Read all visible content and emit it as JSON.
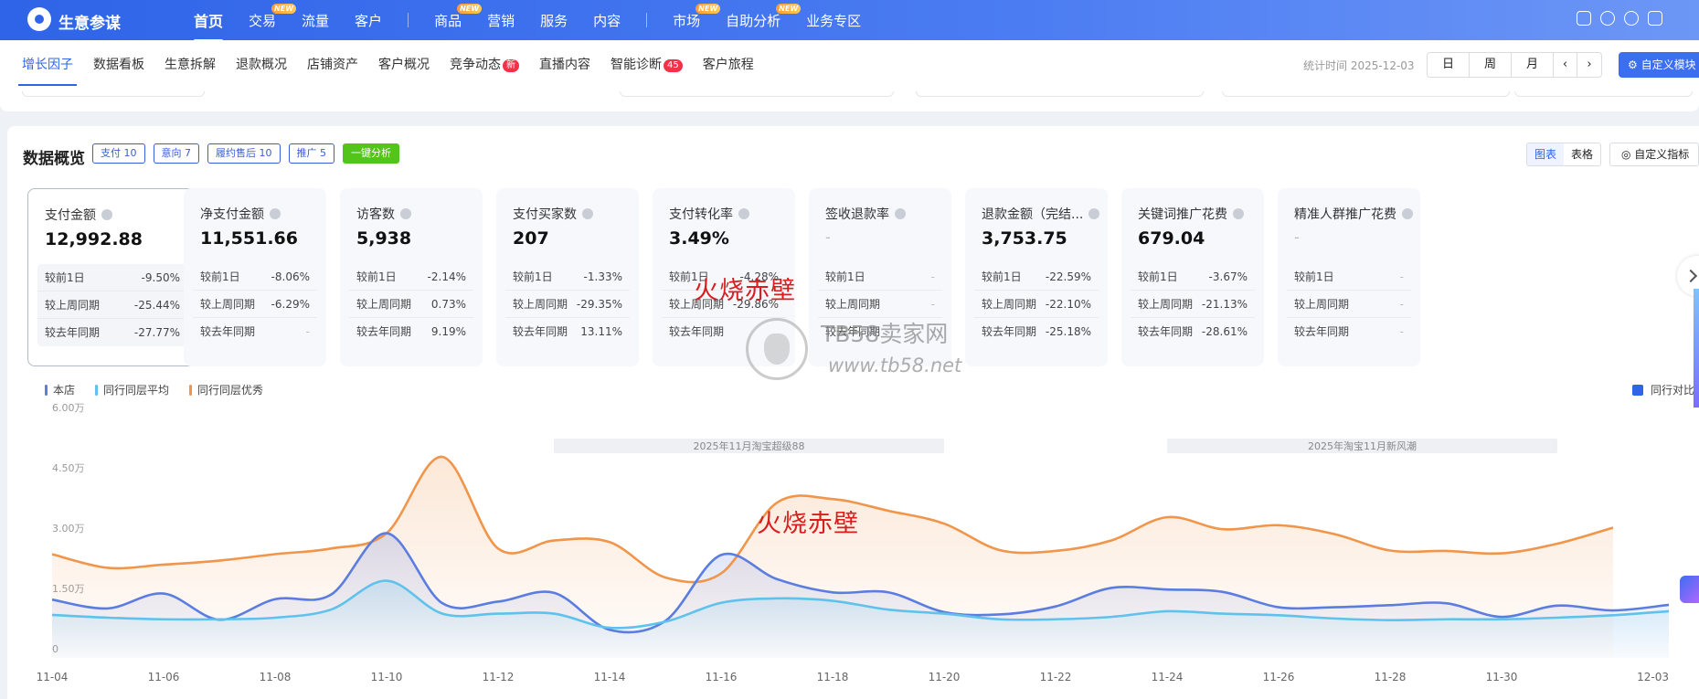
{
  "brand": "生意参谋",
  "top_nav": [
    {
      "label": "首页",
      "active": true
    },
    {
      "label": "交易",
      "new": true
    },
    {
      "label": "流量"
    },
    {
      "label": "客户"
    },
    {
      "label": "商品",
      "new": true
    },
    {
      "label": "营销"
    },
    {
      "label": "服务"
    },
    {
      "label": "内容"
    },
    {
      "label": "市场",
      "new": true
    },
    {
      "label": "自助分析",
      "new": true
    },
    {
      "label": "业务专区"
    }
  ],
  "new_tag": "NEW",
  "sub_nav": [
    {
      "label": "增长因子",
      "active": true
    },
    {
      "label": "数据看板"
    },
    {
      "label": "生意拆解"
    },
    {
      "label": "退款概况"
    },
    {
      "label": "店铺资产"
    },
    {
      "label": "客户概况"
    },
    {
      "label": "竞争动态",
      "badge": "新"
    },
    {
      "label": "直播内容"
    },
    {
      "label": "智能诊断",
      "badge": "45"
    },
    {
      "label": "客户旅程"
    }
  ],
  "stat_time": "统计时间 2025-12-03",
  "period": {
    "day": "日",
    "week": "周",
    "month": "月"
  },
  "custom_module": "自定义模块",
  "overview": {
    "title": "数据概览",
    "chips": [
      "支付 10",
      "意向 7",
      "履约售后 10",
      "推广 5"
    ],
    "one_click": "一键分析",
    "view_chart": "图表",
    "view_table": "表格",
    "custom_metric": "自定义指标"
  },
  "metrics": [
    {
      "name": "支付金额",
      "value": "12,992.88",
      "selected": true,
      "rows": [
        [
          "较前1日",
          "-9.50%"
        ],
        [
          "较上周同期",
          "-25.44%"
        ],
        [
          "较去年同期",
          "-27.77%"
        ]
      ]
    },
    {
      "name": "净支付金额",
      "value": "11,551.66",
      "rows": [
        [
          "较前1日",
          "-8.06%"
        ],
        [
          "较上周同期",
          "-6.29%"
        ],
        [
          "较去年同期",
          "-"
        ]
      ]
    },
    {
      "name": "访客数",
      "value": "5,938",
      "rows": [
        [
          "较前1日",
          "-2.14%"
        ],
        [
          "较上周同期",
          "0.73%"
        ],
        [
          "较去年同期",
          "9.19%"
        ]
      ]
    },
    {
      "name": "支付买家数",
      "value": "207",
      "rows": [
        [
          "较前1日",
          "-1.33%"
        ],
        [
          "较上周同期",
          "-29.35%"
        ],
        [
          "较去年同期",
          "13.11%"
        ]
      ]
    },
    {
      "name": "支付转化率",
      "value": "3.49%",
      "rows": [
        [
          "较前1日",
          "-4.28%"
        ],
        [
          "较上周同期",
          "-29.86%"
        ],
        [
          "较去年同期",
          ""
        ]
      ]
    },
    {
      "name": "签收退款率",
      "value": "-",
      "rows": [
        [
          "较前1日",
          "-"
        ],
        [
          "较上周同期",
          "-"
        ],
        [
          "较去年同期",
          "-"
        ]
      ]
    },
    {
      "name": "退款金额（完结...",
      "value": "3,753.75",
      "rows": [
        [
          "较前1日",
          "-22.59%"
        ],
        [
          "较上周同期",
          "-22.10%"
        ],
        [
          "较去年同期",
          "-25.18%"
        ]
      ]
    },
    {
      "name": "关键词推广花费",
      "value": "679.04",
      "rows": [
        [
          "较前1日",
          "-3.67%"
        ],
        [
          "较上周同期",
          "-21.13%"
        ],
        [
          "较去年同期",
          "-28.61%"
        ]
      ]
    },
    {
      "name": "精准人群推广花费",
      "value": "-",
      "rows": [
        [
          "较前1日",
          "-"
        ],
        [
          "较上周同期",
          "-"
        ],
        [
          "较去年同期",
          "-"
        ]
      ]
    }
  ],
  "compare_label": "同行对比",
  "watermarks": {
    "red": "火烧赤壁",
    "site": "TB58卖家网",
    "url": "www.tb58.net"
  },
  "chart_data": {
    "type": "area",
    "x": [
      "11-04",
      "11-05",
      "11-06",
      "11-07",
      "11-08",
      "11-09",
      "11-10",
      "11-11",
      "11-12",
      "11-13",
      "11-14",
      "11-15",
      "11-16",
      "11-17",
      "11-18",
      "11-19",
      "11-20",
      "11-21",
      "11-22",
      "11-23",
      "11-24",
      "11-25",
      "11-26",
      "11-27",
      "11-28",
      "11-29",
      "11-30",
      "12-01",
      "12-02",
      "12-03"
    ],
    "x_ticks": [
      "11-04",
      "11-06",
      "11-08",
      "11-10",
      "11-12",
      "11-14",
      "11-16",
      "11-18",
      "11-20",
      "11-22",
      "11-24",
      "11-26",
      "11-28",
      "11-30",
      "12-03"
    ],
    "y_ticks": [
      "0",
      "1.50万",
      "3.00万",
      "4.50万",
      "6.00万"
    ],
    "ylim": [
      0,
      60000
    ],
    "series": [
      {
        "name": "本店",
        "color": "#5b7de0",
        "values": [
          14500,
          12300,
          16000,
          9500,
          14600,
          15700,
          31000,
          13600,
          14000,
          16200,
          7000,
          9200,
          25600,
          19600,
          16300,
          16300,
          11400,
          10800,
          12800,
          17400,
          17000,
          16400,
          12600,
          12600,
          13100,
          13600,
          10200,
          13000,
          11800,
          13200
        ]
      },
      {
        "name": "同行同层平均",
        "color": "#5ec2ec",
        "values": [
          10700,
          10000,
          9600,
          9600,
          10000,
          12000,
          19200,
          11000,
          11000,
          11000,
          7500,
          9000,
          13700,
          14800,
          14200,
          12000,
          11000,
          9600,
          9600,
          10200,
          11600,
          11000,
          10600,
          9800,
          9400,
          9600,
          9600,
          10000,
          10600,
          11600
        ]
      },
      {
        "name": "同行同层优秀",
        "color": "#f0954a",
        "values": [
          25800,
          22400,
          23200,
          24200,
          25800,
          27200,
          31000,
          50000,
          27200,
          29200,
          28800,
          20000,
          21000,
          38600,
          39500,
          36600,
          33400,
          26800,
          26600,
          29200,
          35000,
          32000,
          33000,
          30800,
          26700,
          26600,
          26000,
          28400,
          32400
        ]
      }
    ],
    "annotations": [
      {
        "text": "2025年11月淘宝超级88",
        "x_start": "11-13",
        "x_end": "11-20"
      },
      {
        "text": "2025年淘宝11月新风潮",
        "x_start": "11-24",
        "x_end": "12-01"
      }
    ],
    "legend_position": "top-left"
  }
}
